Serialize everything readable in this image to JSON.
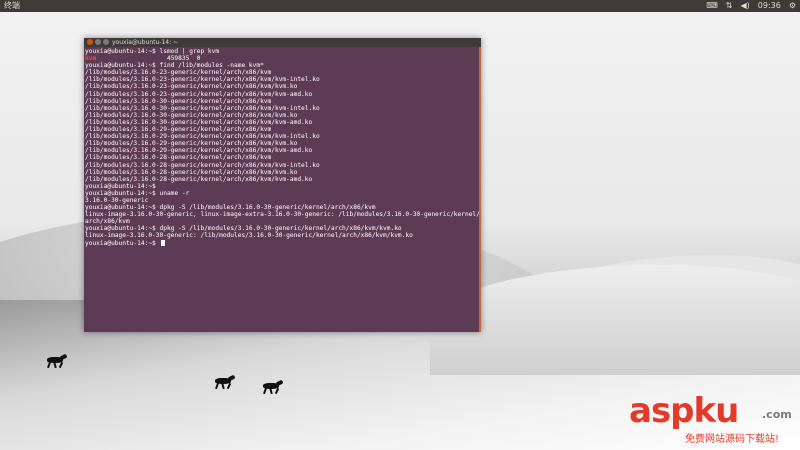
{
  "panel": {
    "title": "终端",
    "indicators": [
      {
        "name": "keyboard-layout-indicator",
        "label": "⌨"
      },
      {
        "name": "network-icon",
        "label": "⇅"
      },
      {
        "name": "volume-icon",
        "label": "◀)"
      },
      {
        "name": "clock",
        "label": "09:36"
      },
      {
        "name": "settings-gear-icon",
        "label": "⚙"
      }
    ]
  },
  "terminal": {
    "title": "youxia@ubuntu-14: ~",
    "lines": [
      {
        "text": "youxia@ubuntu-14:~$ lsmod | grep kvm",
        "red": false
      },
      {
        "text": "kvm                   459835  0",
        "red": false,
        "prefix_red": "kvm"
      },
      {
        "text": "youxia@ubuntu-14:~$ find /lib/modules -name kvm*",
        "red": false
      },
      {
        "text": "/lib/modules/3.16.0-23-generic/kernel/arch/x86/kvm",
        "red": false
      },
      {
        "text": "/lib/modules/3.16.0-23-generic/kernel/arch/x86/kvm/kvm-intel.ko",
        "red": false
      },
      {
        "text": "/lib/modules/3.16.0-23-generic/kernel/arch/x86/kvm/kvm.ko",
        "red": false
      },
      {
        "text": "/lib/modules/3.16.0-23-generic/kernel/arch/x86/kvm/kvm-amd.ko",
        "red": false
      },
      {
        "text": "/lib/modules/3.16.0-30-generic/kernel/arch/x86/kvm",
        "red": false
      },
      {
        "text": "/lib/modules/3.16.0-30-generic/kernel/arch/x86/kvm/kvm-intel.ko",
        "red": false
      },
      {
        "text": "/lib/modules/3.16.0-30-generic/kernel/arch/x86/kvm/kvm.ko",
        "red": false
      },
      {
        "text": "/lib/modules/3.16.0-30-generic/kernel/arch/x86/kvm/kvm-amd.ko",
        "red": false
      },
      {
        "text": "/lib/modules/3.16.0-29-generic/kernel/arch/x86/kvm",
        "red": false
      },
      {
        "text": "/lib/modules/3.16.0-29-generic/kernel/arch/x86/kvm/kvm-intel.ko",
        "red": false
      },
      {
        "text": "/lib/modules/3.16.0-29-generic/kernel/arch/x86/kvm/kvm.ko",
        "red": false
      },
      {
        "text": "/lib/modules/3.16.0-29-generic/kernel/arch/x86/kvm/kvm-amd.ko",
        "red": false
      },
      {
        "text": "/lib/modules/3.16.0-28-generic/kernel/arch/x86/kvm",
        "red": false
      },
      {
        "text": "/lib/modules/3.16.0-28-generic/kernel/arch/x86/kvm/kvm-intel.ko",
        "red": false
      },
      {
        "text": "/lib/modules/3.16.0-28-generic/kernel/arch/x86/kvm/kvm.ko",
        "red": false
      },
      {
        "text": "/lib/modules/3.16.0-28-generic/kernel/arch/x86/kvm/kvm-amd.ko",
        "red": false
      },
      {
        "text": "youxia@ubuntu-14:~$",
        "red": false
      },
      {
        "text": "youxia@ubuntu-14:~$ uname -r",
        "red": false
      },
      {
        "text": "3.16.0-30-generic",
        "red": false
      },
      {
        "text": "youxia@ubuntu-14:~$ dpkg -S /lib/modules/3.16.0-30-generic/kernel/arch/x86/kvm",
        "red": false
      },
      {
        "text": "linux-image-3.16.0-30-generic, linux-image-extra-3.16.0-30-generic: /lib/modules/3.16.0-30-generic/kernel/",
        "red": false
      },
      {
        "text": "arch/x86/kvm",
        "red": false
      },
      {
        "text": "youxia@ubuntu-14:~$ dpkg -S /lib/modules/3.16.0-30-generic/kernel/arch/x86/kvm/kvm.ko",
        "red": false
      },
      {
        "text": "linux-image-3.16.0-30-generic: /lib/modules/3.16.0-30-generic/kernel/arch/x86/kvm/kvm.ko",
        "red": false
      },
      {
        "text": "youxia@ubuntu-14:~$ ",
        "red": false,
        "cursor": true
      }
    ]
  },
  "watermark": {
    "logo": "aspku",
    "domain": ".com",
    "tagline": "免费网站源码下载站!"
  },
  "colors": {
    "terminal_bg": "#5e3b54",
    "panel_bg": "#3c3b37",
    "close_button": "#df4a16",
    "watermark_red": "#e23b2a"
  }
}
